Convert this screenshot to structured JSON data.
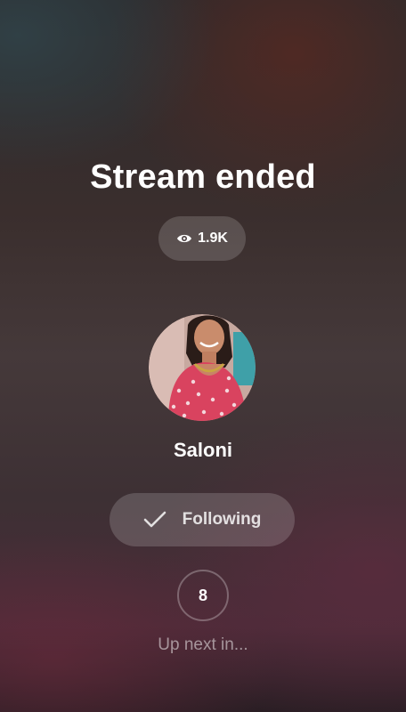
{
  "stream": {
    "title": "Stream ended",
    "views": "1.9K",
    "views_icon": "eye-icon"
  },
  "streamer": {
    "name": "Saloni",
    "follow_label": "Following",
    "follow_icon": "check-icon"
  },
  "next": {
    "countdown": "8",
    "label": "Up next in..."
  },
  "colors": {
    "accent_dress": "#d9435f",
    "pill_bg": "rgba(255,255,255,0.16)"
  }
}
